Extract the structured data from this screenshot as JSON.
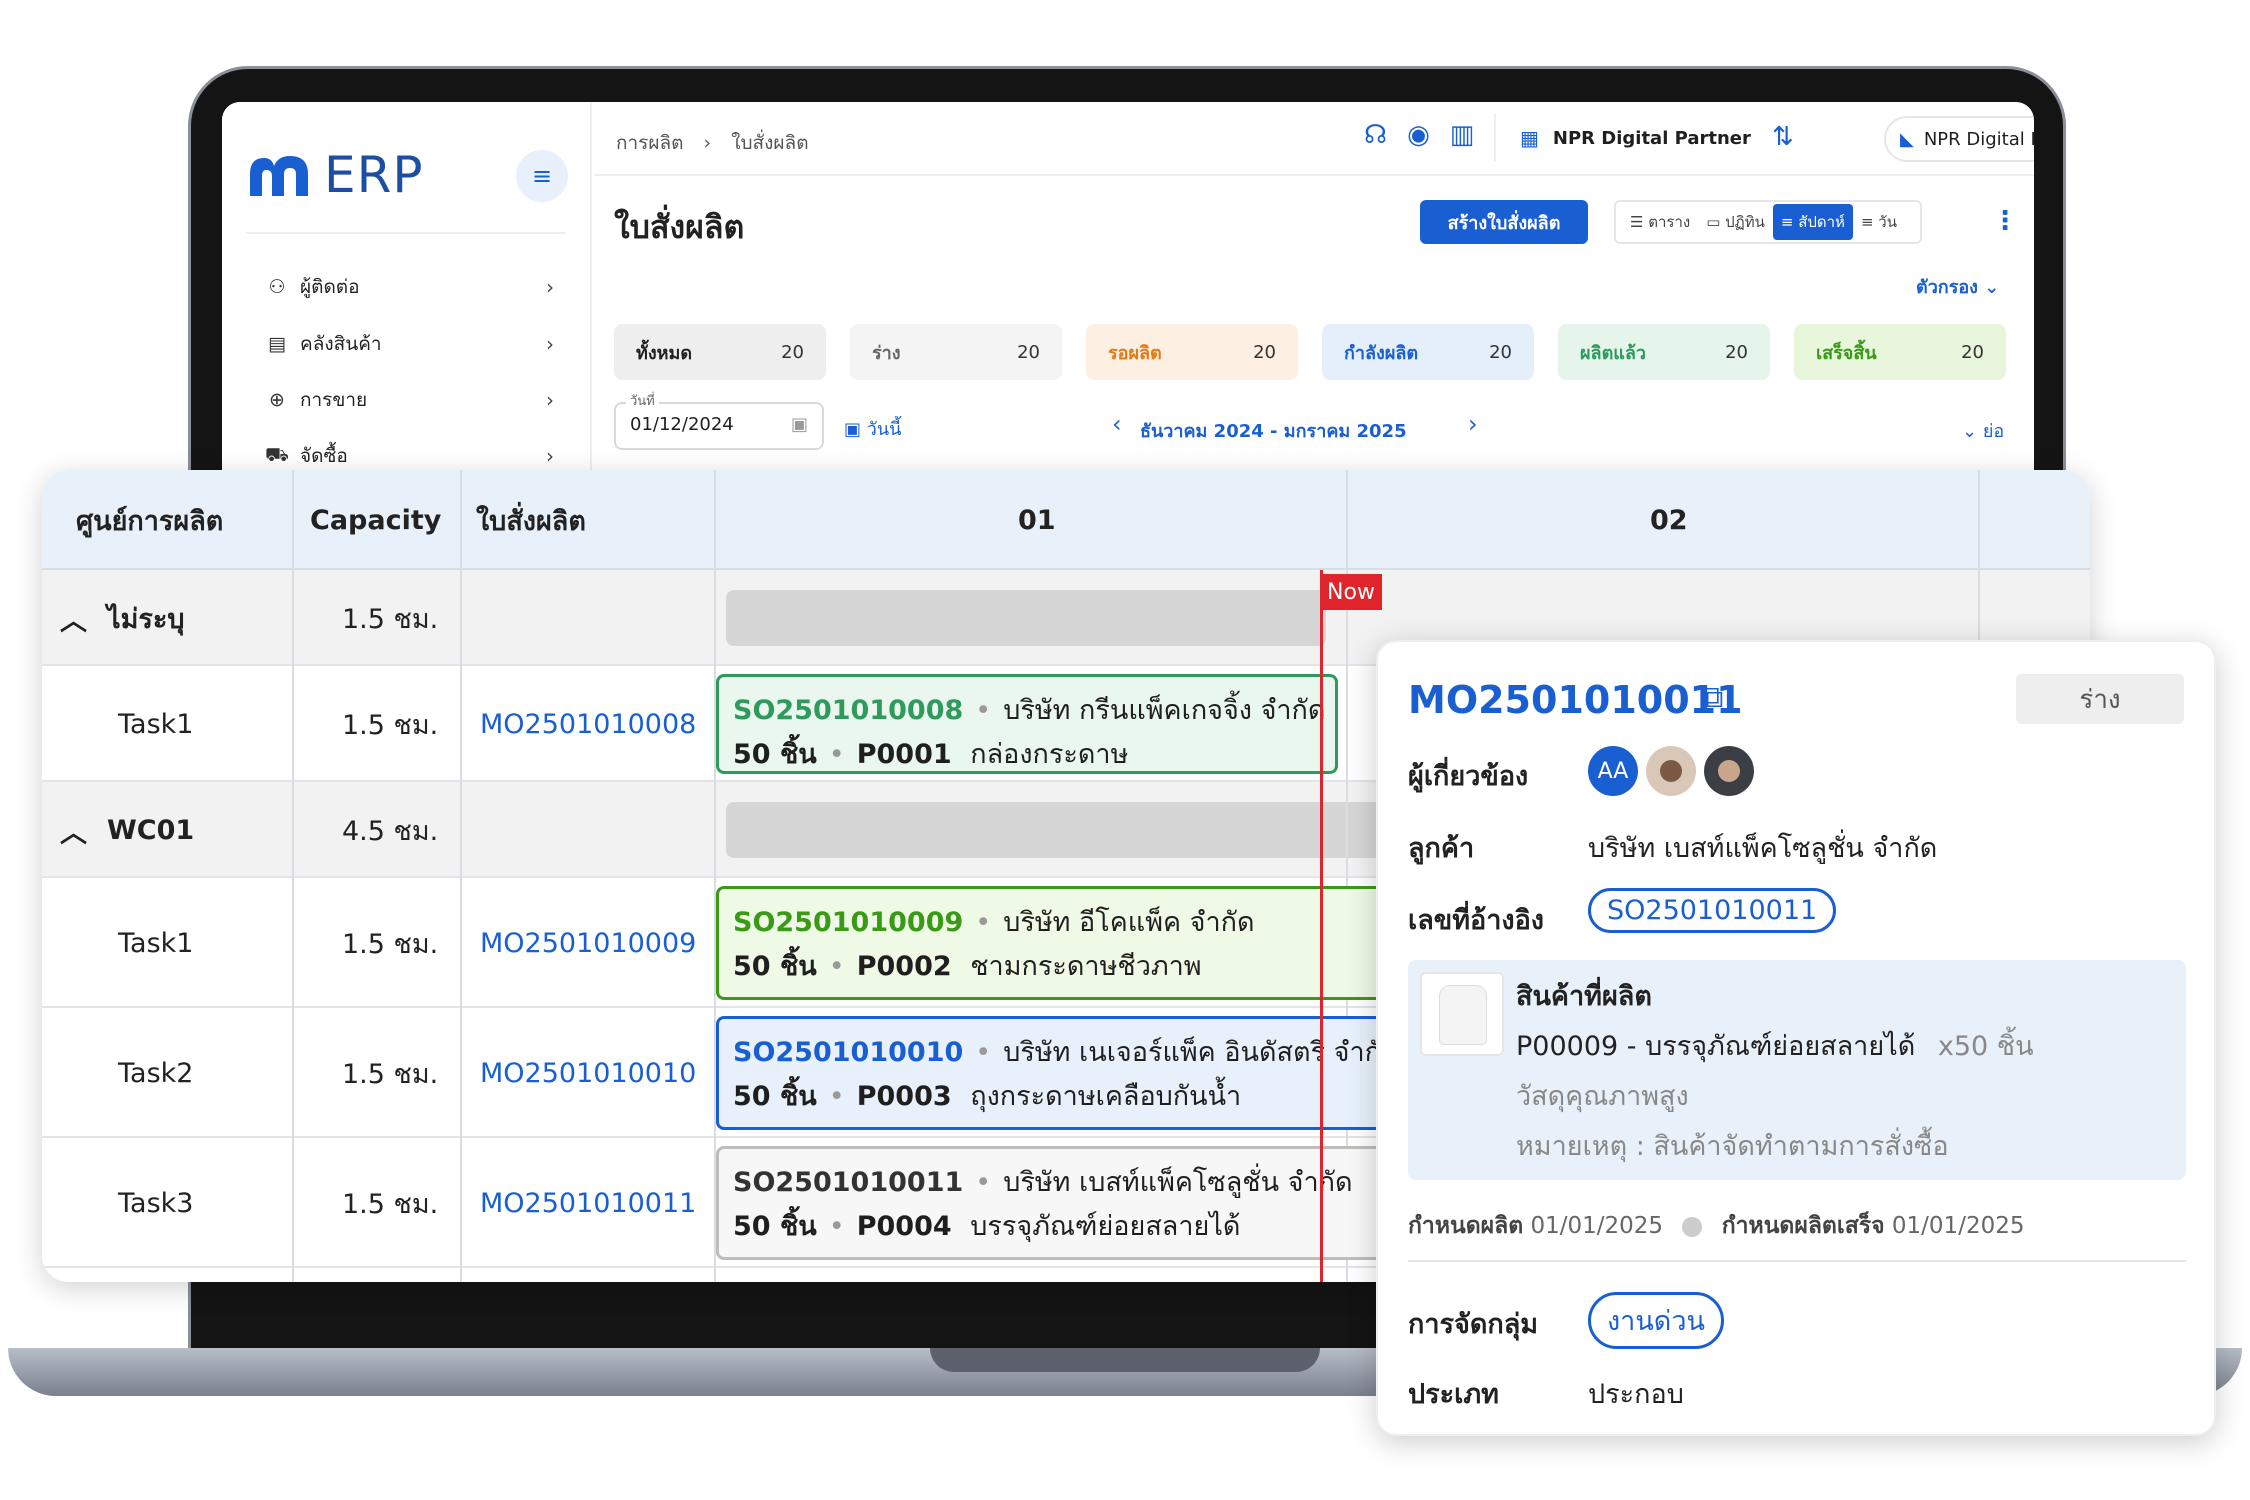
{
  "app": {
    "logo_text": "ERP"
  },
  "sidebar": {
    "items": [
      {
        "label": "ผู้ติดต่อ",
        "icon": "contacts-icon"
      },
      {
        "label": "คลังสินค้า",
        "icon": "inventory-icon"
      },
      {
        "label": "การขาย",
        "icon": "plus-circle-icon"
      },
      {
        "label": "จัดซื้อ",
        "icon": "cart-icon"
      }
    ]
  },
  "topbar": {
    "breadcrumb": [
      "การผลิต",
      "ใบสั่งผลิต"
    ],
    "company": "NPR Digital Partner",
    "user": "NPR Digital Partner Administrator",
    "icons": [
      "support-icon",
      "line-chat-icon",
      "manual-icon"
    ]
  },
  "page": {
    "title": "ใบสั่งผลิต",
    "create_label": "สร้างใบสั่งผลิต",
    "views": [
      {
        "label": "ตาราง",
        "active": false
      },
      {
        "label": "ปฏิทิน",
        "active": false
      },
      {
        "label": "สัปดาห์",
        "active": true
      },
      {
        "label": "วัน",
        "active": false
      }
    ],
    "filter_label": "ตัวกรอง"
  },
  "status_cards": [
    {
      "label": "ทั้งหมด",
      "count": "20",
      "bg": "#eeeeee",
      "fg": "#222222"
    },
    {
      "label": "ร่าง",
      "count": "20",
      "bg": "#f4f4f4",
      "fg": "#666666"
    },
    {
      "label": "รอผลิต",
      "count": "20",
      "bg": "#fdefe2",
      "fg": "#e37b16"
    },
    {
      "label": "กำลังผลิต",
      "count": "20",
      "bg": "#e4effb",
      "fg": "#1a5fd1"
    },
    {
      "label": "ผลิตแล้ว",
      "count": "20",
      "bg": "#e5f5ec",
      "fg": "#2e9a5c"
    },
    {
      "label": "เสร็จสิ้น",
      "count": "20",
      "bg": "#e8f7dc",
      "fg": "#3a9a18"
    }
  ],
  "date_filter": {
    "label": "วันที่",
    "value": "01/12/2024",
    "today_label": "วันนี้",
    "period": "ธันวาคม 2024 - มกราคม 2025",
    "collapse_label": "ย่อ"
  },
  "gantt": {
    "headers": [
      "ศูนย์การผลิต",
      "Capacity",
      "ใบสั่งผลิต",
      "01",
      "02"
    ],
    "now_label": "Now",
    "groups": [
      {
        "name": "ไม่ระบุ",
        "capacity": "1.5 ชม.",
        "tasks": [
          {
            "name": "Task1",
            "capacity": "1.5 ชม.",
            "mo": "MO2501010008",
            "so": "SO2501010008",
            "customer": "บริษัท กรีนแพ็คเกจจิ้ง จำกัด",
            "qty": "50 ชิ้น",
            "product_code": "P0001",
            "product_name": "กล่องกระดาษ",
            "bg": "#eaf7ef",
            "border": "#2e9a5c",
            "so_color": "#2e9a5c"
          }
        ]
      },
      {
        "name": "WC01",
        "capacity": "4.5 ชม.",
        "tasks": [
          {
            "name": "Task1",
            "capacity": "1.5 ชม.",
            "mo": "MO2501010009",
            "so": "SO2501010009",
            "customer": "บริษัท อีโคแพ็ค จำกัด",
            "qty": "50 ชิ้น",
            "product_code": "P0002",
            "product_name": "ชามกระดาษชีวภาพ",
            "bg": "#eef9e6",
            "border": "#3a9a18",
            "so_color": "#3a9a18"
          },
          {
            "name": "Task2",
            "capacity": "1.5 ชม.",
            "mo": "MO2501010010",
            "so": "SO2501010010",
            "customer": "บริษัท เนเจอร์แพ็ค อินดัสตรี จำกัด",
            "qty": "50 ชิ้น",
            "product_code": "P0003",
            "product_name": "ถุงกระดาษเคลือบกันน้ำ",
            "bg": "#e8f1fb",
            "border": "#1a5fd1",
            "so_color": "#1a5fd1"
          },
          {
            "name": "Task3",
            "capacity": "1.5 ชม.",
            "mo": "MO2501010011",
            "so": "SO2501010011",
            "customer": "บริษัท เบสท์แพ็คโซลูชั่น จำกัด",
            "qty": "50 ชิ้น",
            "product_code": "P0004",
            "product_name": "บรรจุภัณฑ์ย่อยสลายได้",
            "bg": "#f7f7f7",
            "border": "#bdbdbd",
            "so_color": "#333333"
          }
        ]
      }
    ]
  },
  "detail": {
    "mo": "MO2501010011",
    "status": "ร่าง",
    "involved_label": "ผู้เกี่ยวข้อง",
    "avatar_initials": "AA",
    "customer_label": "ลูกค้า",
    "customer": "บริษัท เบสท์แพ็คโซลูชั่น จำกัด",
    "ref_label": "เลขที่อ้างอิง",
    "ref": "SO2501010011",
    "product_title": "สินค้าที่ผลิต",
    "product": "P00009 - บรรจุภัณฑ์ย่อยสลายได้",
    "product_qty": "x50 ชิ้น",
    "product_desc": "วัสดุคุณภาพสูง",
    "product_note": "หมายเหตุ : สินค้าจัดทำตามการสั่งซื้อ",
    "start_label": "กำหนดผลิต",
    "start_date": "01/01/2025",
    "end_label": "กำหนดผลิตเสร็จ",
    "end_date": "01/01/2025",
    "group_label": "การจัดกลุ่ม",
    "group_tag": "งานด่วน",
    "type_label": "ประเภท",
    "type": "ประกอบ"
  }
}
